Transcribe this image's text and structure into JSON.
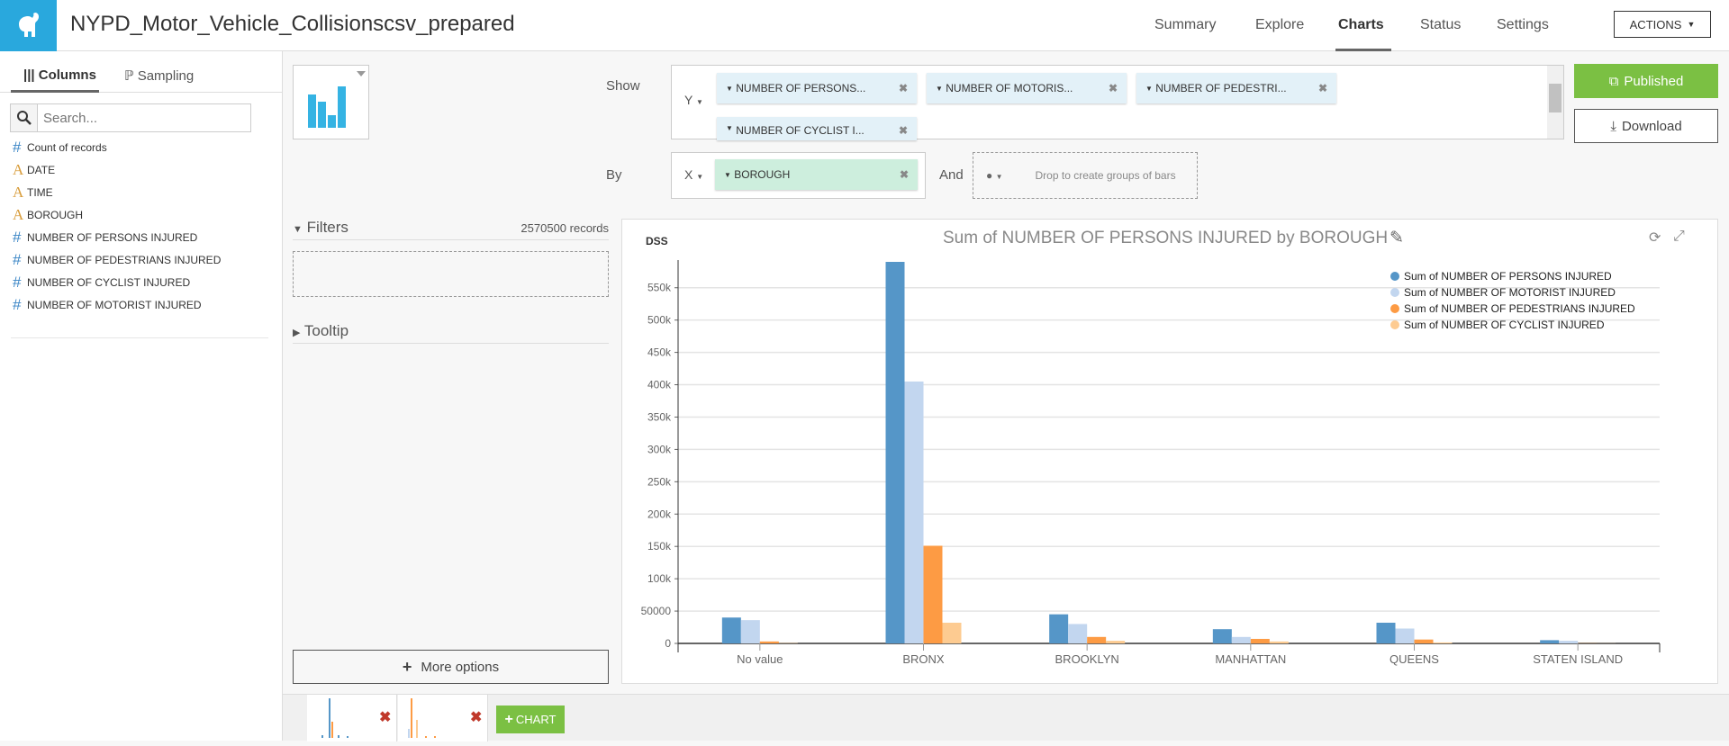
{
  "header": {
    "title": "NYPD_Motor_Vehicle_Collisionscsv_prepared",
    "nav": [
      "Summary",
      "Explore",
      "Charts",
      "Status",
      "Settings"
    ],
    "active_nav": "Charts",
    "actions_label": "ACTIONS"
  },
  "sidebar": {
    "tabs": [
      "Columns",
      "Sampling"
    ],
    "search_placeholder": "Search...",
    "columns": [
      {
        "type": "number",
        "label": "Count of records"
      },
      {
        "type": "alpha",
        "label": "DATE"
      },
      {
        "type": "alpha",
        "label": "TIME"
      },
      {
        "type": "alpha",
        "label": "BOROUGH"
      },
      {
        "type": "number",
        "label": "NUMBER OF PERSONS INJURED"
      },
      {
        "type": "number",
        "label": "NUMBER OF PEDESTRIANS INJURED"
      },
      {
        "type": "number",
        "label": "NUMBER OF CYCLIST INJURED"
      },
      {
        "type": "number",
        "label": "NUMBER OF MOTORIST INJURED"
      }
    ]
  },
  "config": {
    "show_label": "Show",
    "by_label": "By",
    "and_label": "And",
    "y_axis": "Y",
    "x_axis": "X",
    "y_pills": [
      "NUMBER OF PERSONS...",
      "NUMBER OF MOTORIS...",
      "NUMBER OF PEDESTRI...",
      "NUMBER OF CYCLIST I..."
    ],
    "x_pill": "BOROUGH",
    "drop_hint": "Drop to create groups of bars",
    "published": "Published",
    "download": "Download"
  },
  "filters": {
    "label": "Filters",
    "records": "2570500 records",
    "tooltip_label": "Tooltip",
    "more_options": "More options"
  },
  "bottom": {
    "add_chart": "CHART"
  },
  "chart_data": {
    "type": "bar",
    "brand": "DSS",
    "title": "Sum of NUMBER OF PERSONS INJURED by BOROUGH",
    "categories": [
      "No value",
      "BRONX",
      "BROOKLYN",
      "MANHATTAN",
      "QUEENS",
      "STATEN ISLAND"
    ],
    "series": [
      {
        "name": "Sum of NUMBER OF PERSONS INJURED",
        "color": "#5596c8",
        "values": [
          40000,
          590000,
          45000,
          22000,
          32000,
          5000
        ]
      },
      {
        "name": "Sum of NUMBER OF MOTORIST INJURED",
        "color": "#c2d6ef",
        "values": [
          36000,
          405000,
          30000,
          10000,
          23000,
          4000
        ]
      },
      {
        "name": "Sum of NUMBER OF PEDESTRIANS INJURED",
        "color": "#fd9b44",
        "values": [
          3000,
          151000,
          10000,
          7000,
          6000,
          300
        ]
      },
      {
        "name": "Sum of NUMBER OF CYCLIST INJURED",
        "color": "#fdcb91",
        "values": [
          500,
          32000,
          4000,
          3000,
          1500,
          200
        ]
      }
    ],
    "yticks": [
      "0",
      "50000",
      "100k",
      "150k",
      "200k",
      "250k",
      "300k",
      "350k",
      "400k",
      "450k",
      "500k",
      "550k"
    ],
    "ylim": [
      0,
      590000
    ],
    "grid": true,
    "legend": "top-right"
  }
}
